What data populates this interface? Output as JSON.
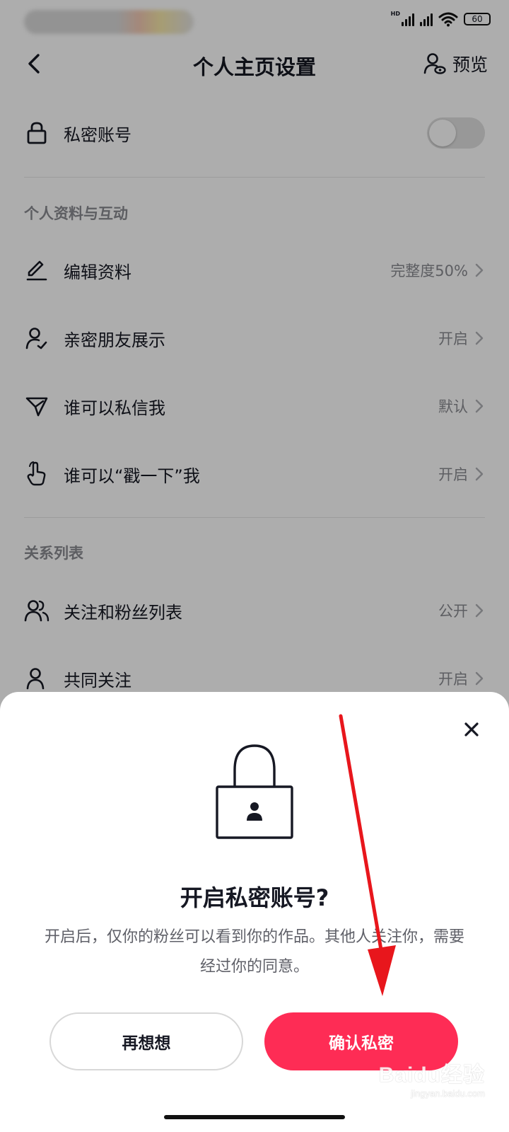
{
  "header": {
    "title": "个人主页设置",
    "preview_label": "预览"
  },
  "status_bar": {
    "network_label": "HD",
    "battery": "60"
  },
  "settings": {
    "private_account": {
      "label": "私密账号",
      "enabled": false
    },
    "sections": [
      {
        "title": "个人资料与互动",
        "items": [
          {
            "label": "编辑资料",
            "value": "完整度50%",
            "icon": "edit-pen-icon"
          },
          {
            "label": "亲密朋友展示",
            "value": "开启",
            "icon": "close-friends-icon"
          },
          {
            "label": "谁可以私信我",
            "value": "默认",
            "icon": "send-message-icon"
          },
          {
            "label": "谁可以“戳一下”我",
            "value": "开启",
            "icon": "poke-hand-icon"
          }
        ]
      },
      {
        "title": "关系列表",
        "items": [
          {
            "label": "关注和粉丝列表",
            "value": "公开",
            "icon": "users-icon"
          },
          {
            "label": "共同关注",
            "value": "开启",
            "icon": "user-icon"
          }
        ]
      }
    ]
  },
  "dialog": {
    "icon": "lock-icon",
    "title": "开启私密账号?",
    "description": "开启后，仅你的粉丝可以看到你的作品。其他人关注你，需要经过你的同意。",
    "cancel_label": "再想想",
    "confirm_label": "确认私密"
  },
  "colors": {
    "accent": "#fe2c55",
    "annotation_arrow": "#e8161c"
  },
  "watermark": {
    "brand": "Baidu经验",
    "url": "jingyan.baidu.com"
  }
}
